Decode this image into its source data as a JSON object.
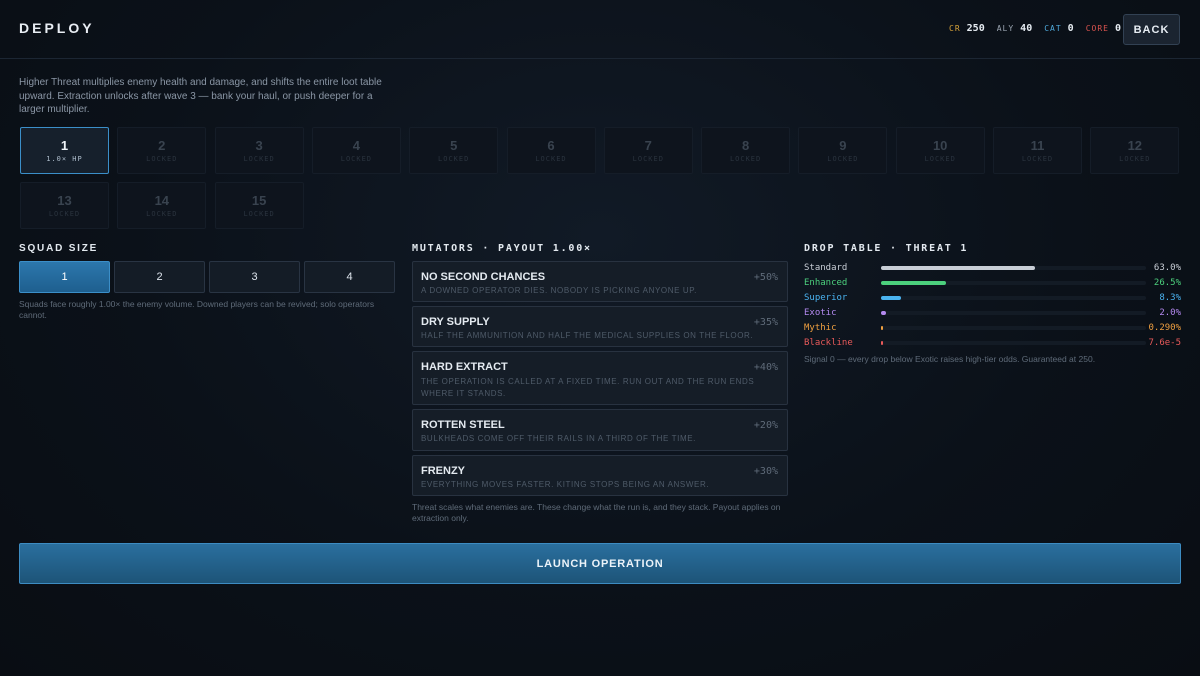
{
  "header": {
    "title": "DEPLOY",
    "back_label": "BACK",
    "currencies": [
      {
        "label": "CR",
        "value": "250",
        "color": "#d9a43a"
      },
      {
        "label": "ALY",
        "value": "40",
        "color": "#9aa4b0"
      },
      {
        "label": "CAT",
        "value": "0",
        "color": "#4ea7d8"
      },
      {
        "label": "CORE",
        "value": "0",
        "color": "#d9534f"
      }
    ]
  },
  "intro": "Higher Threat multiplies enemy health and damage, and shifts the entire loot table upward. Extraction unlocks after wave 3 — bank your haul, or push deeper for a larger multiplier.",
  "threat_levels": [
    {
      "num": "1",
      "sub": "1.0× HP",
      "active": true
    },
    {
      "num": "2",
      "sub": "LOCKED"
    },
    {
      "num": "3",
      "sub": "LOCKED"
    },
    {
      "num": "4",
      "sub": "LOCKED"
    },
    {
      "num": "5",
      "sub": "LOCKED"
    },
    {
      "num": "6",
      "sub": "LOCKED"
    },
    {
      "num": "7",
      "sub": "LOCKED"
    },
    {
      "num": "8",
      "sub": "LOCKED"
    },
    {
      "num": "9",
      "sub": "LOCKED"
    },
    {
      "num": "10",
      "sub": "LOCKED"
    },
    {
      "num": "11",
      "sub": "LOCKED"
    },
    {
      "num": "12",
      "sub": "LOCKED"
    },
    {
      "num": "13",
      "sub": "LOCKED"
    },
    {
      "num": "14",
      "sub": "LOCKED"
    },
    {
      "num": "15",
      "sub": "LOCKED"
    }
  ],
  "squad": {
    "label": "SQUAD SIZE",
    "options": [
      "1",
      "2",
      "3",
      "4"
    ],
    "selected": "1",
    "note": "Squads face roughly 1.00× the enemy volume. Downed players can be revived; solo operators cannot."
  },
  "mutators": {
    "label": "MUTATORS · PAYOUT 1.00×",
    "items": [
      {
        "name": "NO SECOND CHANCES",
        "pct": "+50%",
        "desc": "A DOWNED OPERATOR DIES. NOBODY IS PICKING ANYONE UP."
      },
      {
        "name": "DRY SUPPLY",
        "pct": "+35%",
        "desc": "HALF THE AMMUNITION AND HALF THE MEDICAL SUPPLIES ON THE FLOOR."
      },
      {
        "name": "HARD EXTRACT",
        "pct": "+40%",
        "desc": "THE OPERATION IS CALLED AT A FIXED TIME. RUN OUT AND THE RUN ENDS WHERE IT STANDS."
      },
      {
        "name": "ROTTEN STEEL",
        "pct": "+20%",
        "desc": "BULKHEADS COME OFF THEIR RAILS IN A THIRD OF THE TIME."
      },
      {
        "name": "FRENZY",
        "pct": "+30%",
        "desc": "EVERYTHING MOVES FASTER. KITING STOPS BEING AN ANSWER."
      }
    ],
    "note": "Threat scales what enemies are. These change what the run is, and they stack. Payout applies on extraction only."
  },
  "drop_table": {
    "label": "DROP TABLE · THREAT 1",
    "rows": [
      {
        "name": "Standard",
        "value": "63.0%",
        "fraction": 0.63,
        "color": "#c8ced6"
      },
      {
        "name": "Enhanced",
        "value": "26.5%",
        "fraction": 0.265,
        "color": "#4cd07d"
      },
      {
        "name": "Superior",
        "value": "8.3%",
        "fraction": 0.083,
        "color": "#4ab3f0"
      },
      {
        "name": "Exotic",
        "value": "2.0%",
        "fraction": 0.02,
        "color": "#b48af0"
      },
      {
        "name": "Mythic",
        "value": "0.290%",
        "fraction": 0.0029,
        "color": "#f0a040"
      },
      {
        "name": "Blackline",
        "value": "7.6e-5",
        "fraction": 7.6e-05,
        "color": "#e85a5a"
      }
    ],
    "note": "Signal 0 — every drop below Exotic raises high-tier odds. Guaranteed at 250."
  },
  "launch_label": "LAUNCH OPERATION"
}
